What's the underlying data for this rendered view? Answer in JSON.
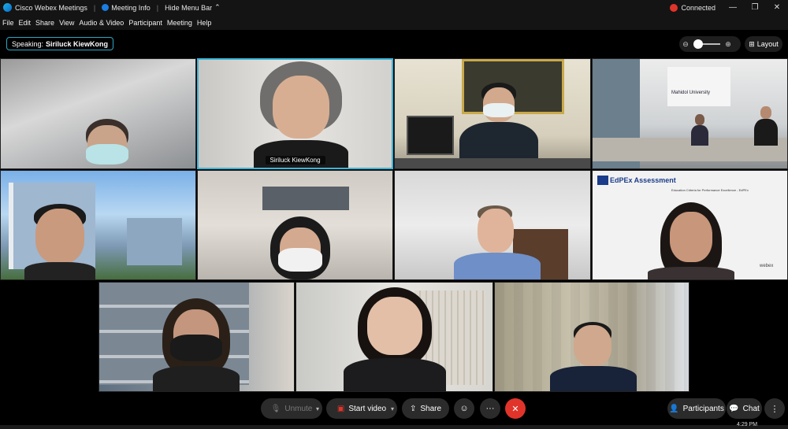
{
  "titlebar": {
    "app_name": "Cisco Webex Meetings",
    "meeting_info": "Meeting Info",
    "hide_menu": "Hide Menu Bar",
    "status": "Connected"
  },
  "menu": [
    "File",
    "Edit",
    "Share",
    "View",
    "Audio & Video",
    "Participant",
    "Meeting",
    "Help"
  ],
  "speaking": {
    "prefix": "Speaking:",
    "name": "Siriluck KiewKong"
  },
  "layout_label": "Layout",
  "active_name": "Siriluck KiewKong",
  "room_sign": "Mahidol University",
  "slide_title": "EdPEx Assessment",
  "slide_subtitle": "Education Criteria for Performance Excellence - EdPEx",
  "slide_brand": "webex",
  "controls": {
    "unmute": "Unmute",
    "start_video": "Start video",
    "share": "Share",
    "participants": "Participants",
    "chat": "Chat"
  },
  "clock": "4:29 PM",
  "colors": {
    "accent": "#3bb6d9",
    "end_call": "#e0342b",
    "start_video_icon": "#e0342b"
  }
}
